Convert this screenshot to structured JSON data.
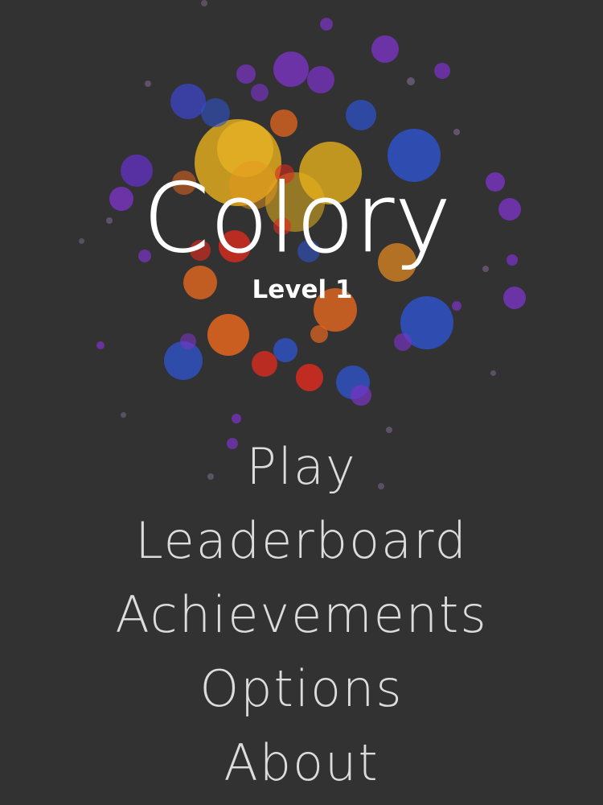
{
  "game": {
    "title": "Colory",
    "level_label": "Level 1"
  },
  "menu": {
    "items": [
      {
        "label": "Play"
      },
      {
        "label": "Leaderboard"
      },
      {
        "label": "Achievements"
      },
      {
        "label": "Options"
      },
      {
        "label": "About"
      }
    ]
  },
  "colors": {
    "background": "#323232",
    "title_text": "#ffffff",
    "menu_text": "#dcdcdc",
    "bubble_palette": [
      "#e8b21c",
      "#e5661e",
      "#d92b1e",
      "#2f52c8",
      "#7a33c4",
      "#5a4ad0"
    ]
  }
}
